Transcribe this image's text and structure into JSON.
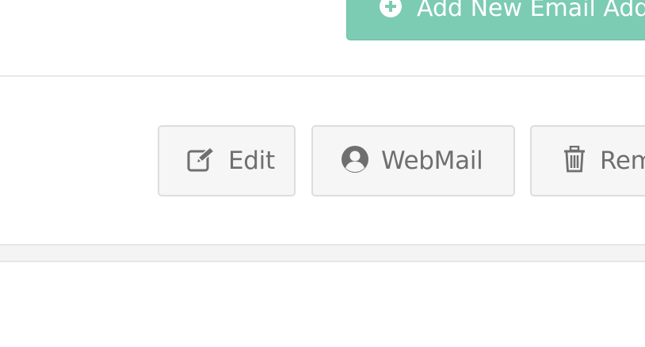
{
  "add_button": {
    "label": "Add New Email Address",
    "icon": "plus-circle-icon",
    "color": "#7ccbb3"
  },
  "actions": {
    "edit": {
      "label": "Edit",
      "icon": "edit-icon"
    },
    "webmail": {
      "label": "WebMail",
      "icon": "user-circle-icon"
    },
    "remove": {
      "label": "Remove",
      "icon": "trash-icon"
    }
  },
  "colors": {
    "button_bg": "#f6f6f6",
    "button_border": "#dddddd",
    "button_text": "#6f6f6f"
  }
}
